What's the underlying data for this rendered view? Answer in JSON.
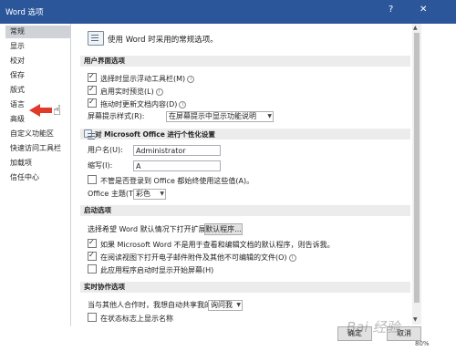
{
  "window": {
    "title": "Word 选项",
    "help_glyph": "?",
    "close_glyph": "✕"
  },
  "sidebar": {
    "items": [
      {
        "label": "常规",
        "selected": true
      },
      {
        "label": "显示"
      },
      {
        "label": "校对"
      },
      {
        "label": "保存"
      },
      {
        "label": "版式"
      },
      {
        "label": "语言"
      },
      {
        "label": "高级"
      },
      {
        "label": "自定义功能区"
      },
      {
        "label": "快速访问工具栏"
      },
      {
        "label": "加载项"
      },
      {
        "label": "信任中心"
      }
    ]
  },
  "main": {
    "intro": "使用 Word 时采用的常规选项。",
    "ui_section": {
      "title": "用户界面选项",
      "opt1": "选择时显示浮动工具栏(M)",
      "opt2": "启用实时预览(L)",
      "opt3": "拖动时更新文档内容(D)",
      "style_label": "屏幕提示样式(R):",
      "style_value": "在屏幕提示中显示功能说明"
    },
    "personal_section": {
      "title": "对 Microsoft Office 进行个性化设置",
      "username_label": "用户名(U):",
      "username_value": "Administrator",
      "initials_label": "缩写(I):",
      "initials_value": "A",
      "always_use": "不管是否登录到 Office 都始终使用这些值(A)。",
      "theme_label": "Office 主题(T):",
      "theme_value": "彩色"
    },
    "startup_section": {
      "title": "启动选项",
      "ext_label": "选择希望 Word 默认情况下打开扩展名:",
      "ext_button": "默认程序...",
      "opt1": "如果 Microsoft Word 不是用于查看和编辑文档的默认程序，则告诉我。",
      "opt2": "在阅读视图下打开电子邮件附件及其他不可编辑的文件(O)",
      "opt3": "此应用程序启动时显示开始屏幕(H)"
    },
    "realtime_section": {
      "title": "实时协作选项",
      "share_label": "当与其他人合作时，我想自动共享我的更改:",
      "share_value": "询问我",
      "opt1": "在状态标志上显示名称"
    }
  },
  "footer": {
    "ok": "确定",
    "cancel": "取消"
  },
  "status": {
    "zoom": "80%"
  },
  "watermark": "Bai 经验",
  "colors": {
    "titlebar": "#2b579a",
    "arrow": "#e03a2a"
  }
}
